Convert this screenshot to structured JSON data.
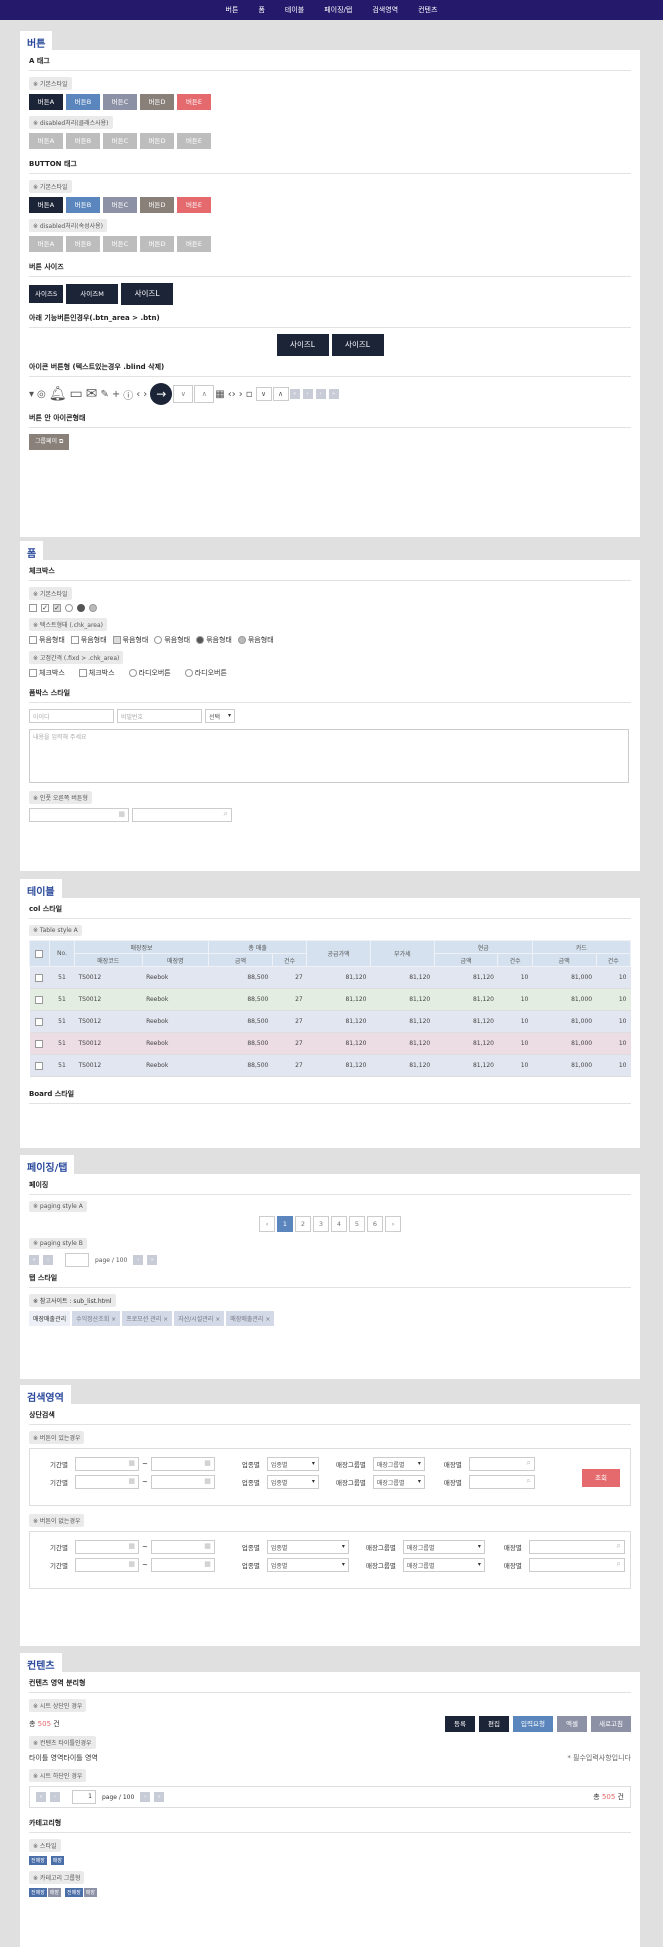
{
  "nav": [
    "버튼",
    "폼",
    "테이블",
    "페이징/탭",
    "검색영역",
    "컨텐츠"
  ],
  "s1": {
    "tab": "버튼",
    "a_tag": "A 태그",
    "basic": "※ 기본스타일",
    "disabled_class": "※ disabled처리(클래스사용)",
    "btn_tag": "BUTTON 태그",
    "disabled_attr": "※ disabled처리(속성사용)",
    "btns": [
      "버튼A",
      "버튼B",
      "버튼C",
      "버튼D",
      "버튼E"
    ],
    "size_title": "버튼 사이즈",
    "sizes": [
      "사이즈S",
      "사이즈M",
      "사이즈L"
    ],
    "area_title": "아래 기능버튼인경우(.btn_area > .btn)",
    "area_btns": [
      "사이즈L",
      "사이즈L"
    ],
    "icon_title": "아이콘 버튼형 (텍스트있는경우 .blind 삭제)",
    "inicon_title": "버튼 안 아이콘형태",
    "inicon_btn": "그룹페이"
  },
  "s2": {
    "tab": "폼",
    "check_title": "체크박스",
    "basic": "※ 기본스타일",
    "text_type": "※ 텍스트형태 (.chk_area)",
    "fixed": "※ 고정간격 (.fixd > .chk_area)",
    "opt": "묶음형태",
    "fixed_opts": [
      "체크박스",
      "체크박스",
      "라디오버튼",
      "라디오버튼"
    ],
    "form_title": "폼박스 스타일",
    "id_ph": "아이디",
    "pw_ph": "비밀번호",
    "select": "선택",
    "textarea_ph": "내용을 입력해 주세요",
    "icon_right": "※ 인풋 오른쪽 버튼형"
  },
  "s3": {
    "tab": "테이블",
    "col_title": "col 스타일",
    "style_a": "※ Table style A",
    "h_no": "No.",
    "h_store": "매장정보",
    "h_code": "매장코드",
    "h_name": "매장명",
    "h_total": "총 매출",
    "h_amt": "금액",
    "h_cnt": "건수",
    "h_supply": "공급가액",
    "h_vat": "부가세",
    "h_cash": "현금",
    "h_card": "카드",
    "rows": [
      [
        "51",
        "TS0012",
        "Reebok",
        "88,500",
        "27",
        "81,120",
        "81,120",
        "81,120",
        "10",
        "81,000",
        "10"
      ],
      [
        "51",
        "TS0012",
        "Reebok",
        "88,500",
        "27",
        "81,120",
        "81,120",
        "81,120",
        "10",
        "81,000",
        "10"
      ],
      [
        "51",
        "TS0012",
        "Reebok",
        "88,500",
        "27",
        "81,120",
        "81,120",
        "81,120",
        "10",
        "81,000",
        "10"
      ],
      [
        "51",
        "TS0012",
        "Reebok",
        "88,500",
        "27",
        "81,120",
        "81,120",
        "81,120",
        "10",
        "81,000",
        "10"
      ],
      [
        "51",
        "TS0012",
        "Reebok",
        "88,500",
        "27",
        "81,120",
        "81,120",
        "81,120",
        "10",
        "81,000",
        "10"
      ]
    ],
    "row_colors": [
      "#e2e6f0",
      "#e4ede2",
      "#e2e6f0",
      "#ecdde4",
      "#e2e6f0"
    ],
    "board_title": "Board 스타일"
  },
  "s4": {
    "tab": "페이징/탭",
    "paging_title": "페이징",
    "style_a": "※ paging style A",
    "pages": [
      "1",
      "2",
      "3",
      "4",
      "5",
      "6"
    ],
    "style_b": "※ paging style B",
    "page_of": "page / 100",
    "tab_title": "탭 스타일",
    "ref": "※ 참고사이트 : sub_list.html",
    "tabs": [
      "매장매출관리",
      "수익정산조회",
      "프로모션 관리",
      "자산/시설관리",
      "매장매출관리"
    ]
  },
  "s5": {
    "tab": "검색영역",
    "title": "상단검색",
    "with_btn": "※ 버튼이 있는경우",
    "without_btn": "※ 버튼이 없는경우",
    "period": "기간별",
    "biz": "업종별",
    "biz_val": "업종별",
    "group": "매장그룹별",
    "group_val": "매장그룹별",
    "store": "매장별",
    "search": "조회"
  },
  "s6": {
    "tab": "컨텐츠",
    "title": "컨텐츠 영역 분리형",
    "top_case": "※ 시트 상단인 경우",
    "total_pre": "총 ",
    "total_num": "505",
    "total_suf": " 건",
    "actions": [
      "등록",
      "편집",
      "입력요청",
      "엑셀",
      "새로고침"
    ],
    "title_case": "※ 컨텐츠 타이틀인경우",
    "title_area": "타이틀 영역타이틀 영역",
    "required": "* 필수입력사항입니다",
    "bottom_case": "※ 시트 하단인 경우",
    "page_num": "1",
    "page_of": "page / 100",
    "cat_title": "카테고리형",
    "style": "※ 스타일",
    "cat_group": "※ 카테고리 그룹형",
    "cat": [
      "전매장",
      "매장"
    ],
    "cat2": [
      "전매장",
      "매장",
      "전매장",
      "매장"
    ]
  }
}
